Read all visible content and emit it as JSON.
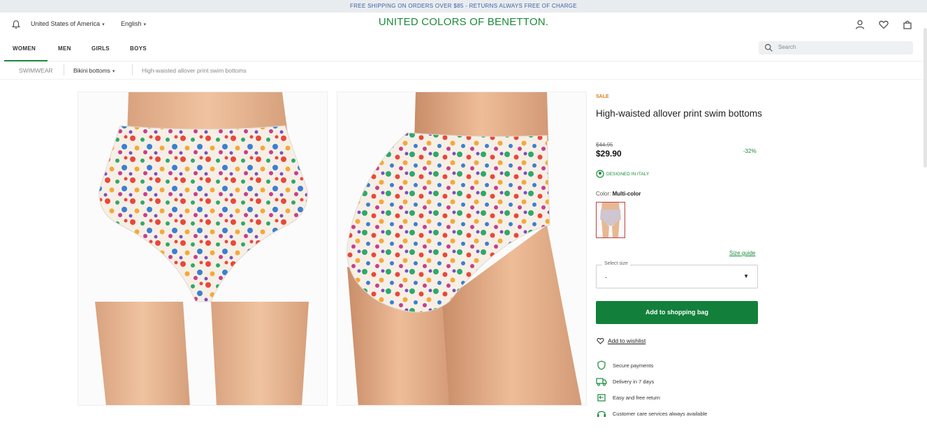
{
  "promo_banner": "FREE SHIPPING ON ORDERS OVER $85 - RETURNS ALWAYS FREE OF CHARGE",
  "header": {
    "country": "United States of America",
    "language": "English",
    "logo": "UNITED COLORS OF BENETTON."
  },
  "nav": {
    "items": [
      "WOMEN",
      "MEN",
      "GIRLS",
      "BOYS"
    ],
    "active": "WOMEN",
    "search_placeholder": "Search"
  },
  "breadcrumb": {
    "items": [
      "SWIMWEAR",
      "Bikini bottoms",
      "High-waisted allover print swim bottoms"
    ]
  },
  "product": {
    "badge": "SALE",
    "title": "High-waisted allover print swim bottoms",
    "old_price": "$44.95",
    "price": "$29.90",
    "discount": "-32%",
    "designed_in": "DESIGNED IN ITALY",
    "color_label": "Color:",
    "color_value": "Multi-color",
    "size_guide": "Size guide",
    "size_label": "Select size",
    "size_value": "-",
    "add_to_bag": "Add to shopping bag",
    "add_to_wishlist": "Add to wishlist",
    "features": [
      "Secure payments",
      "Delivery in 7 days",
      "Easy and free return",
      "Customer care services always available"
    ]
  },
  "colors": {
    "brand_green": "#1b8a3c",
    "button_green": "#12803b",
    "sale_orange": "#e07a1c",
    "promo_text": "#3d5fa8"
  },
  "icons": [
    "bell-icon",
    "user-icon",
    "heart-icon",
    "bag-icon",
    "search-icon",
    "shield-icon",
    "truck-icon",
    "return-icon",
    "headset-icon"
  ]
}
